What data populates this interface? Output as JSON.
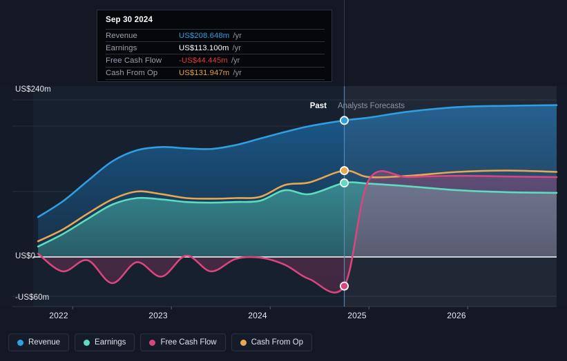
{
  "tooltip": {
    "date": "Sep 30 2024",
    "rows": [
      {
        "name": "Revenue",
        "value": "US$208.648m",
        "unit": "/yr",
        "color": "#2e9fe0"
      },
      {
        "name": "Earnings",
        "value": "US$113.100m",
        "unit": "/yr",
        "color": "#ffffff"
      },
      {
        "name": "Free Cash Flow",
        "value": "-US$44.445m",
        "unit": "/yr",
        "color": "#e5383b"
      },
      {
        "name": "Cash From Op",
        "value": "US$131.947m",
        "unit": "/yr",
        "color": "#e8a33d"
      }
    ]
  },
  "regions": {
    "past_label": "Past",
    "forecast_label": "Analysts Forecasts"
  },
  "axis": {
    "y_labels": [
      "US$240m",
      "US$0",
      "-US$60m"
    ],
    "x_labels": [
      "2022",
      "2023",
      "2024",
      "2025",
      "2026"
    ]
  },
  "legend": [
    {
      "label": "Revenue",
      "color": "#2e9fe0"
    },
    {
      "label": "Earnings",
      "color": "#5ddcc0"
    },
    {
      "label": "Free Cash Flow",
      "color": "#d9467f"
    },
    {
      "label": "Cash From Op",
      "color": "#e8a851"
    }
  ],
  "chart_data": {
    "type": "area",
    "title": "",
    "xlabel": "",
    "ylabel": "US$m",
    "ylim": [
      -60,
      240
    ],
    "xlim": [
      2021.6,
      2026.9
    ],
    "grid": true,
    "legend_position": "bottom-left",
    "divider_x": 2024.75,
    "divider_label_left": "Past",
    "divider_label_right": "Analysts Forecasts",
    "highlight_date": "Sep 30 2024",
    "x": [
      2021.65,
      2021.9,
      2022.15,
      2022.4,
      2022.65,
      2022.9,
      2023.15,
      2023.4,
      2023.65,
      2023.9,
      2024.15,
      2024.4,
      2024.75,
      2025.0,
      2025.4,
      2025.9,
      2026.4,
      2026.9
    ],
    "series": [
      {
        "name": "Revenue",
        "color": "#2e9fe0",
        "values": [
          61,
          85,
          116,
          146,
          163,
          168,
          166,
          165,
          171,
          181,
          191,
          200,
          208.648,
          213,
          222,
          229,
          231,
          232
        ]
      },
      {
        "name": "Cash From Op",
        "color": "#e8a851",
        "values": [
          24,
          42,
          66,
          88,
          100,
          96,
          90,
          89,
          90,
          92,
          110,
          114,
          131.947,
          122,
          124,
          130,
          132,
          130
        ]
      },
      {
        "name": "Earnings",
        "color": "#5ddcc0",
        "values": [
          16,
          35,
          58,
          80,
          90,
          88,
          84,
          83,
          84,
          86,
          102,
          96,
          113.1,
          112,
          108,
          102,
          99,
          98
        ]
      },
      {
        "name": "Free Cash Flow",
        "color": "#d9467f",
        "values": [
          5,
          -22,
          -5,
          -40,
          -8,
          -30,
          2,
          -22,
          -3,
          -1,
          -12,
          -34,
          -44.445,
          118,
          122,
          124,
          123,
          122
        ]
      }
    ],
    "markers": [
      {
        "series": "Revenue",
        "x": 2024.75,
        "y": 208.648
      },
      {
        "series": "Cash From Op",
        "x": 2024.75,
        "y": 131.947
      },
      {
        "series": "Earnings",
        "x": 2024.75,
        "y": 113.1
      },
      {
        "series": "Free Cash Flow",
        "x": 2024.75,
        "y": -44.445
      }
    ]
  }
}
